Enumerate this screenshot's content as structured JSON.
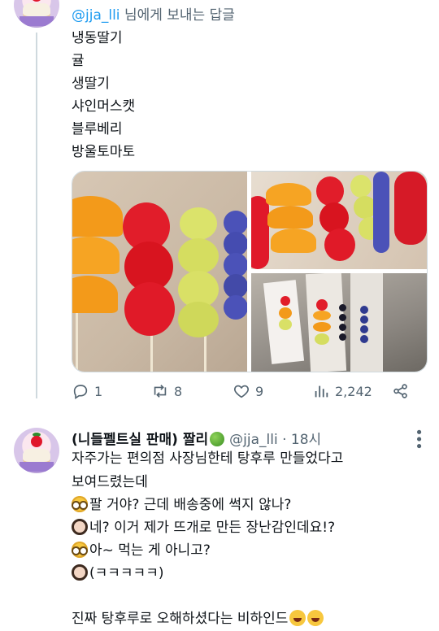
{
  "reply_header": {
    "handle": "@jja_lli",
    "suffix": " 님에게 보내는 답글"
  },
  "tweet1": {
    "lines": [
      "냉동딸기",
      "귤",
      "생딸기",
      "샤인머스캣",
      "블루베리",
      "방울토마토"
    ]
  },
  "actions": {
    "reply_count": "1",
    "retweet_count": "8",
    "like_count": "9",
    "view_count": "2,242"
  },
  "tweet2": {
    "display_name": "(니들펠트실 판매) 짤리",
    "handle": "@jja_lli",
    "time": "· 18시",
    "lines": [
      "자주가는 편의점 사장님한테 탕후루 만들었다고",
      "보여드렸는데",
      "팔 거야? 근데 배송중에 썩지 않나?",
      "네? 이거 제가 뜨개로 만든 장난감인데요!?",
      "아~ 먹는 게 아니고?",
      "(ㅋㅋㅋㅋㅋ)",
      "",
      "진짜 탕후루로 오해하셨다는 비하인드"
    ]
  },
  "colors": {
    "accent": "#1d9bf0",
    "muted": "#536471",
    "text": "#0f1419"
  },
  "icons": [
    "reply-icon",
    "retweet-icon",
    "like-icon",
    "views-icon",
    "share-icon",
    "more-icon",
    "green-ball-emoji"
  ]
}
